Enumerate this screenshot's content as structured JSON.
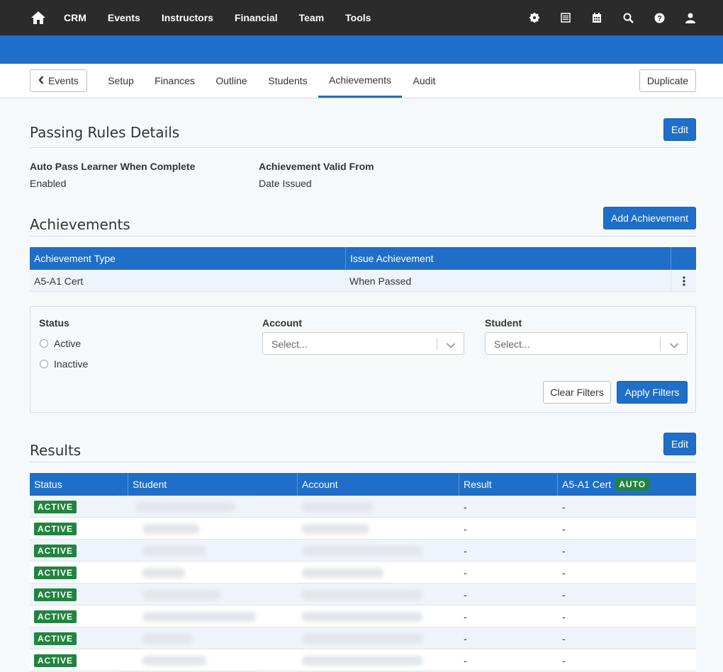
{
  "nav": {
    "links": [
      "CRM",
      "Events",
      "Instructors",
      "Financial",
      "Team",
      "Tools"
    ]
  },
  "subnav": {
    "back_label": "Events",
    "tabs": [
      "Setup",
      "Finances",
      "Outline",
      "Students",
      "Achievements",
      "Audit"
    ],
    "active_tab": "Achievements",
    "duplicate_label": "Duplicate"
  },
  "passing_rules": {
    "title": "Passing Rules Details",
    "edit_label": "Edit",
    "fields": [
      {
        "label": "Auto Pass Learner When Complete",
        "value": "Enabled"
      },
      {
        "label": "Achievement Valid From",
        "value": "Date Issued"
      }
    ]
  },
  "achievements": {
    "title": "Achievements",
    "add_label": "Add Achievement",
    "headers": [
      "Achievement Type",
      "Issue Achievement"
    ],
    "rows": [
      {
        "type": "A5-A1 Cert",
        "issue": "When Passed"
      }
    ]
  },
  "filters": {
    "status_label": "Status",
    "status_options": [
      "Active",
      "Inactive"
    ],
    "account_label": "Account",
    "account_placeholder": "Select...",
    "student_label": "Student",
    "student_placeholder": "Select...",
    "clear_label": "Clear Filters",
    "apply_label": "Apply Filters"
  },
  "results": {
    "title": "Results",
    "edit_label": "Edit",
    "headers": [
      "Status",
      "Student",
      "Account",
      "Result",
      "A5-A1 Cert"
    ],
    "auto_badge": "AUTO",
    "rows": [
      {
        "status": "ACTIVE",
        "result": "-",
        "cert": "-"
      },
      {
        "status": "ACTIVE",
        "result": "-",
        "cert": "-"
      },
      {
        "status": "ACTIVE",
        "result": "-",
        "cert": "-"
      },
      {
        "status": "ACTIVE",
        "result": "-",
        "cert": "-"
      },
      {
        "status": "ACTIVE",
        "result": "-",
        "cert": "-"
      },
      {
        "status": "ACTIVE",
        "result": "-",
        "cert": "-"
      },
      {
        "status": "ACTIVE",
        "result": "-",
        "cert": "-"
      },
      {
        "status": "ACTIVE",
        "result": "-",
        "cert": "-"
      }
    ]
  },
  "colors": {
    "accent": "#1f6ec7",
    "topbar": "#2b2b2b",
    "active_badge": "#21843f"
  }
}
